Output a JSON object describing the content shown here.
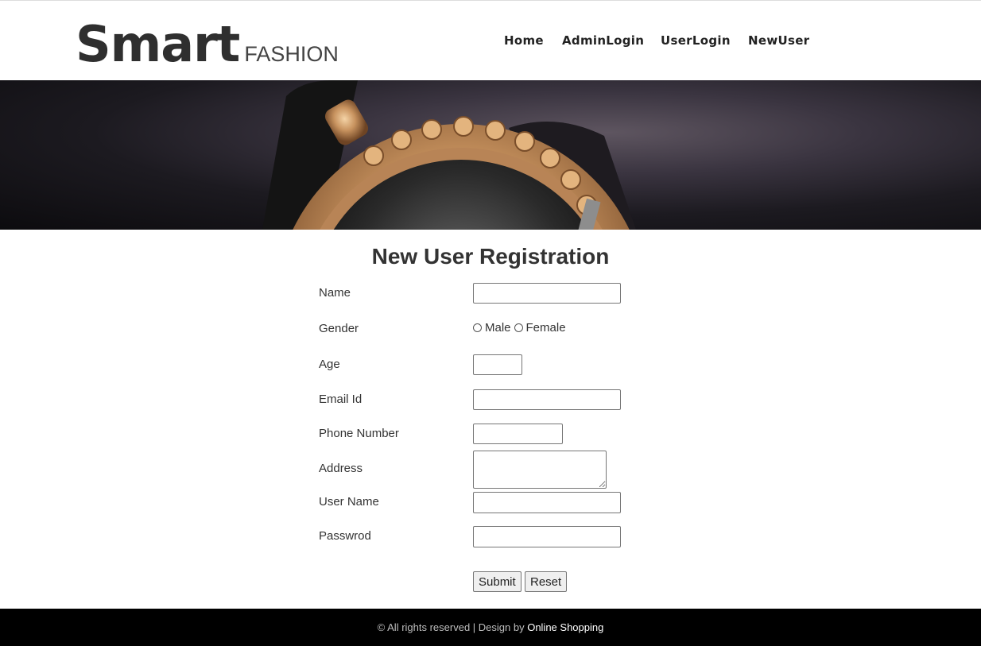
{
  "header": {
    "logo_main": "Smart",
    "logo_sub": "FASHION",
    "nav": [
      "Home",
      "AdminLogin",
      "UserLogin",
      "NewUser"
    ]
  },
  "form": {
    "title": "New User Registration",
    "labels": {
      "name": "Name",
      "gender": "Gender",
      "age": "Age",
      "email": "Email Id",
      "phone": "Phone Number",
      "address": "Address",
      "username": "User Name",
      "password": "Passwrod"
    },
    "gender_options": [
      "Male",
      "Female"
    ],
    "values": {
      "name": "",
      "age": "",
      "email": "",
      "phone": "",
      "address": "",
      "username": "",
      "password": ""
    },
    "submit_label": "Submit",
    "reset_label": "Reset"
  },
  "footer": {
    "text": "© All rights reserved | Design by",
    "link": "Online Shopping"
  }
}
